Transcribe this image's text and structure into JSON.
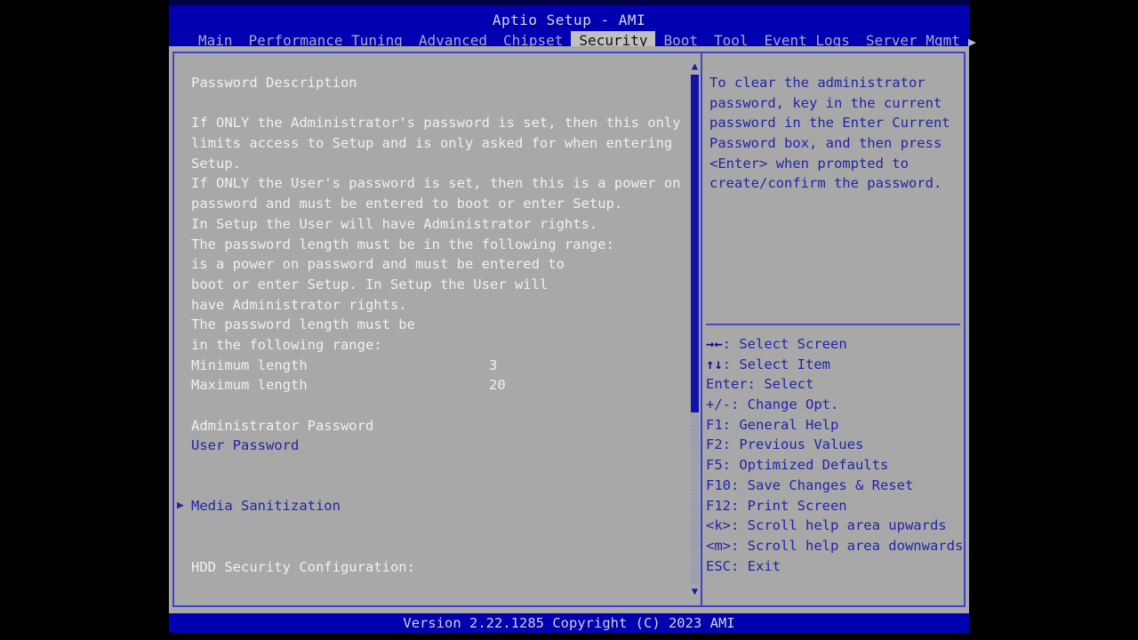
{
  "window": {
    "app_title": "Aptio Setup - AMI",
    "footer": "Version 2.22.1285 Copyright (C) 2023 AMI"
  },
  "menu": {
    "items": [
      {
        "label": "Main",
        "active": false
      },
      {
        "label": "Performance Tuning",
        "active": false
      },
      {
        "label": "Advanced",
        "active": false
      },
      {
        "label": "Chipset",
        "active": false
      },
      {
        "label": "Security",
        "active": true
      },
      {
        "label": "Boot",
        "active": false
      },
      {
        "label": "Tool",
        "active": false
      },
      {
        "label": "Event Logs",
        "active": false
      },
      {
        "label": "Server Mgmt",
        "active": false
      }
    ],
    "more_icon": "▶"
  },
  "main": {
    "lines": [
      {
        "text": "Password Description",
        "style": "white"
      },
      {
        "text": "",
        "style": "white"
      },
      {
        "text": "If ONLY the Administrator's password is set, then this only",
        "style": "white"
      },
      {
        "text": "limits access to Setup and is only asked for when entering",
        "style": "white"
      },
      {
        "text": "Setup.",
        "style": "white"
      },
      {
        "text": "If ONLY the User's password is set, then this is a power on",
        "style": "white"
      },
      {
        "text": "password and must be entered to boot or enter Setup.",
        "style": "white"
      },
      {
        "text": "In Setup the User will have Administrator rights.",
        "style": "white"
      },
      {
        "text": "The password length must be in the following range:",
        "style": "white"
      },
      {
        "text": "is a power on password and must be entered to",
        "style": "white"
      },
      {
        "text": "boot or enter Setup. In Setup the User will",
        "style": "white"
      },
      {
        "text": "have Administrator rights.",
        "style": "white"
      },
      {
        "text": "The password length must be",
        "style": "white"
      },
      {
        "text": "in the following range:",
        "style": "white"
      },
      {
        "text": "Minimum length",
        "style": "white",
        "value": "3"
      },
      {
        "text": "Maximum length",
        "style": "white",
        "value": "20"
      },
      {
        "text": "",
        "style": "white"
      },
      {
        "text": "Administrator Password",
        "style": "white"
      },
      {
        "text": "User Password",
        "style": "blue"
      },
      {
        "text": "",
        "style": "white"
      },
      {
        "text": "",
        "style": "white"
      },
      {
        "text": "Media Sanitization",
        "style": "blue",
        "submenu": true
      },
      {
        "text": "",
        "style": "white"
      },
      {
        "text": "",
        "style": "white"
      },
      {
        "text": "HDD Security Configuration:",
        "style": "white"
      }
    ],
    "scrollbar": {
      "up_arrow": "▲",
      "down_arrow": "▼"
    }
  },
  "help": {
    "lines": [
      "To clear the administrator",
      "password, key in the current",
      "password in the Enter Current",
      "Password box, and then press",
      "<Enter> when prompted to",
      "create/confirm the password."
    ],
    "keys": [
      {
        "glyph": "→←",
        "text": ": Select Screen"
      },
      {
        "glyph": "↑↓",
        "text": ": Select Item"
      },
      {
        "glyph": "",
        "text": "Enter: Select"
      },
      {
        "glyph": "",
        "text": "+/-: Change Opt."
      },
      {
        "glyph": "",
        "text": "F1: General Help"
      },
      {
        "glyph": "",
        "text": "F2: Previous Values"
      },
      {
        "glyph": "",
        "text": "F5: Optimized Defaults"
      },
      {
        "glyph": "",
        "text": "F10: Save Changes & Reset"
      },
      {
        "glyph": "",
        "text": "F12: Print Screen"
      },
      {
        "glyph": "",
        "text": "<k>: Scroll help area upwards"
      },
      {
        "glyph": "",
        "text": "<m>: Scroll help area downwards"
      },
      {
        "glyph": "",
        "text": "ESC: Exit"
      }
    ]
  },
  "colors": {
    "bar_blue": "#0000b0",
    "panel_gray": "#a8a8a8",
    "text_blue": "#2424a8",
    "accent_border": "#4040c8"
  }
}
